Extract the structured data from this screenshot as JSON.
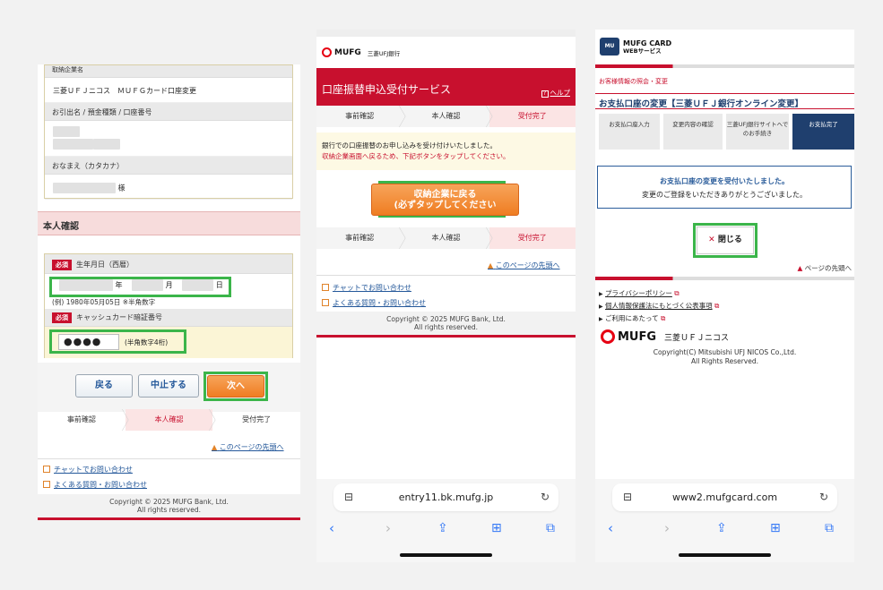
{
  "panel1": {
    "header_cut": "取納企業名",
    "company_value": "三菱ＵＦＪニコス　ＭＵＦＧカード口座変更",
    "bank_label": "お引出名 / 預金種類 / 口座番号",
    "name_label": "おなまえ（カタカナ）",
    "name_suffix": "様",
    "section_title": "本人確認",
    "required_badge": "必須",
    "birth_label": "生年月日（西暦）",
    "year_unit": "年",
    "month_unit": "月",
    "day_unit": "日",
    "birth_example": "(例) 1980年05月05日 ※半角数字",
    "pin_label": "キャッシュカード暗証番号",
    "pin_value": "●●●●",
    "pin_hint": "(半角数字4桁)",
    "back_btn": "戻る",
    "cancel_btn": "中止する",
    "next_btn": "次へ",
    "steps": [
      "事前確認",
      "本人確認",
      "受付完了"
    ],
    "top_link": "このページの先頭へ",
    "chat_link": "チャットでお問い合わせ",
    "faq_link": "よくある質問・お問い合わせ",
    "copyright": "Copyright © 2025 MUFG Bank, Ltd.",
    "rights": "All rights reserved."
  },
  "panel2": {
    "logo_text": "MUFG",
    "bank_name": "三菱UFJ銀行",
    "title": "口座振替申込受付サービス",
    "help": "ヘルプ",
    "steps": [
      "事前確認",
      "本人確認",
      "受付完了"
    ],
    "msg1": "銀行での口座振替のお申し込みを受け付けいたしました。",
    "msg2": "収納企業画面へ戻るため、下記ボタンをタップしてください。",
    "return_btn_line1": "収納企業に戻る",
    "return_btn_line2": "(必ずタップしてください",
    "top_link": "このページの先頭へ",
    "chat_link": "チャットでお問い合わせ",
    "faq_link": "よくある質問・お問い合わせ",
    "copyright": "Copyright © 2025 MUFG Bank, Ltd.",
    "rights": "All rights reserved.",
    "url": "entry11.bk.mufg.jp"
  },
  "panel3": {
    "logo_line1": "MUFG CARD",
    "logo_line2": "WEBサービス",
    "breadcrumb": "お客様情報の照会・変更",
    "title": "お支払口座の変更【三菱ＵＦＪ銀行オンライン変更】",
    "steps": [
      "お支払口座入力",
      "変更内容の確認",
      "三菱UFJ銀行サイトへでのお手続き",
      "お支払完了"
    ],
    "done_msg1": "お支払口座の変更を受付いたしました。",
    "done_msg2": "変更のご登録をいただきありがとうございました。",
    "close_btn": "閉じる",
    "top_link": "ページの先頭へ",
    "links": [
      "プライバシーポリシー",
      "個人情報保護法にもとづく公表事項",
      "ご利用にあたって"
    ],
    "company_logo": "MUFG",
    "company_name": "三菱ＵＦＪニコス",
    "copyright": "Copyright(C) Mitsubishi UFJ NICOS Co.,Ltd.",
    "rights": "All Rights Reserved.",
    "url": "www2.mufgcard.com"
  },
  "colors": {
    "mufg_red": "#c8102e",
    "highlight_green": "#3bb54a",
    "orange": "#ef7d22",
    "navy": "#1f3f6e"
  }
}
